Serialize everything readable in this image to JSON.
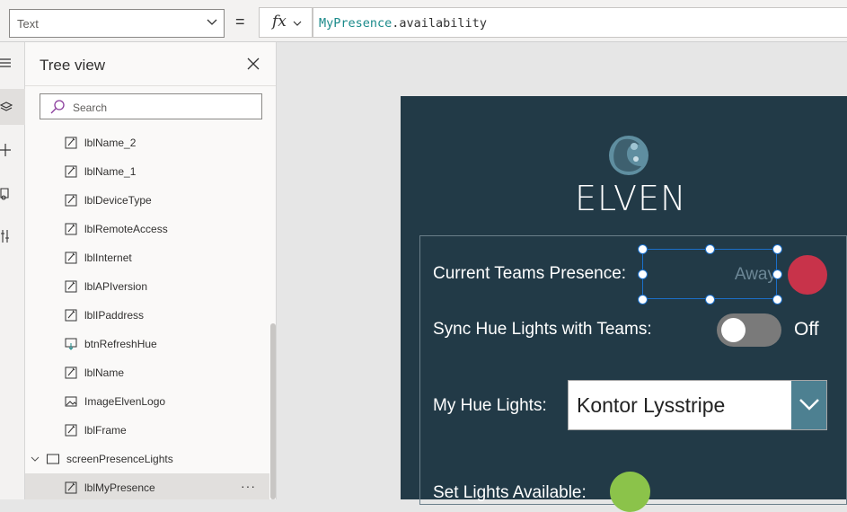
{
  "formula_bar": {
    "property": "Text",
    "equals": "=",
    "fx_label": "fx",
    "formula_ident": "MyPresence",
    "formula_rest": ".availability"
  },
  "rail": {
    "icons": [
      "hamburger-icon",
      "layers-icon",
      "plus-icon",
      "media-icon",
      "controls-icon"
    ]
  },
  "tree": {
    "title": "Tree view",
    "search_placeholder": "Search",
    "items": [
      {
        "label": "lblName_2",
        "icon": "label-icon"
      },
      {
        "label": "lblName_1",
        "icon": "label-icon"
      },
      {
        "label": "lblDeviceType",
        "icon": "label-icon"
      },
      {
        "label": "lblRemoteAccess",
        "icon": "label-icon"
      },
      {
        "label": "lblInternet",
        "icon": "label-icon"
      },
      {
        "label": "lblAPIversion",
        "icon": "label-icon"
      },
      {
        "label": "lblIPaddress",
        "icon": "label-icon"
      },
      {
        "label": "btnRefreshHue",
        "icon": "button-icon"
      },
      {
        "label": "lblName",
        "icon": "label-icon"
      },
      {
        "label": "ImageElvenLogo",
        "icon": "image-icon"
      },
      {
        "label": "lblFrame",
        "icon": "label-icon"
      },
      {
        "label": "screenPresenceLights",
        "icon": "screen-icon"
      },
      {
        "label": "lblMyPresence",
        "icon": "label-icon"
      }
    ],
    "more": "···"
  },
  "app": {
    "logo_text": "ELVEN",
    "presence_label": "Current Teams Presence:",
    "presence_value": "Away",
    "presence_color": "#c8334a",
    "sync_label": "Sync Hue Lights with Teams:",
    "sync_state": "Off",
    "lights_label": "My Hue Lights:",
    "lights_selected": "Kontor Lysstripe",
    "available_label": "Set Lights Available:",
    "available_color": "#8bc34a",
    "background": "#223a47"
  }
}
